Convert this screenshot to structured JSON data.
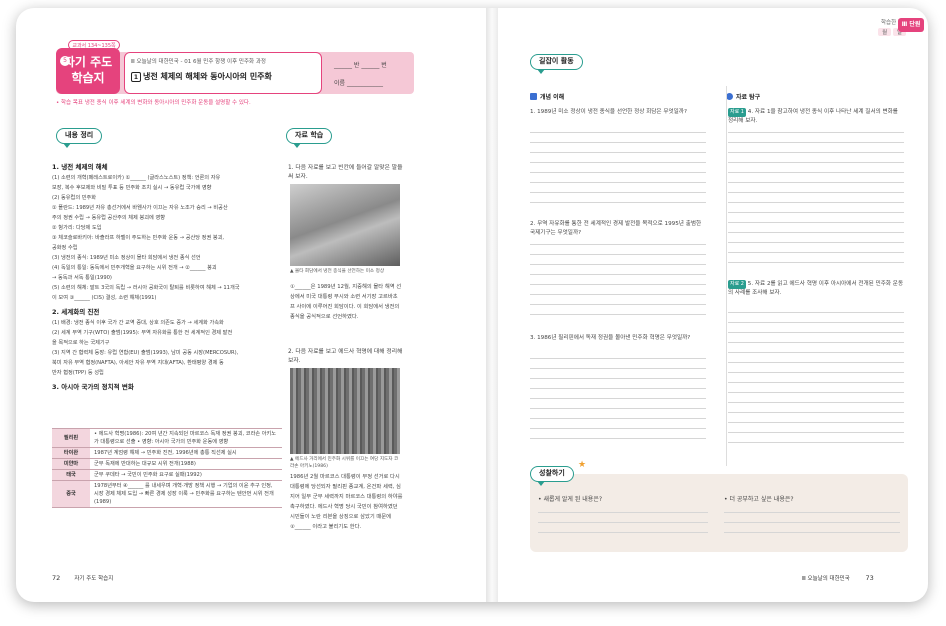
{
  "left_page": {
    "textbook_ref": "교과서 134~135쪽",
    "logo_line1": "자기 주도",
    "logo_line2": "학습지",
    "logo_badge": "5",
    "chapter_path": "Ⅲ 오늘날의 대한민국 - 01 6월 민주 항쟁 이후 민주화 과정",
    "lesson_title": "냉전 체제의 해체와 동아시아의 민주화",
    "lesson_number": "1",
    "class_field": "______ 반 ______ 번",
    "name_field": "이름 ____________",
    "goal": "• 학습 목표  냉전 종식 이후 세계의 변화와 동아시아의 민주화 운동을 설명할 수 있다.",
    "section_summary": "내용 정리",
    "section_material": "자료 학습",
    "summary": {
      "h1": "1. 냉전 체제의 해체",
      "s1": [
        "(1) 소련의 개혁(페레스트로이카) ①______ (글라스노스트) 정책: 언론의 자유",
        "보장, 복수 후보제와 비밀 투표 등 민주화 조치 실시 → 동유럽 국가에 영향",
        "(2) 동유럽의 민주화",
        "① 폴란드: 1989년 자유 총선거에서 바웬사가 이끄는 자유 노조가 승리 → 비공산",
        "주의 정권 수립 → 동유럽 공산주의 체제 붕괴에 영향",
        "② 헝가리: 다당제 도입",
        "③ 체코슬로바키아: 바츨라프 하벨이 주도하는 민주화 운동 → 공산당 정권 붕괴,",
        "공화정 수립",
        "(3) 냉전의 종식: 1989년 미소 정상이 몰타 회담에서 냉전 종식 선언",
        "(4) 독일의 통일: 동독에서 민주개혁을 요구하는 시위 전개 → ②______ 붕괴",
        "→ 동독과 서독 통일(1990)",
        "(5) 소련의 해체: 발트 3국의 독립 → 러시아 공화국이 탈퇴를 비롯하여 해체 → 11개국",
        "이 모여 ③______ (CIS) 결성, 소련 해체(1991)"
      ],
      "h2": "2. 세계화의 진전",
      "s2": [
        "(1) 배경: 냉전 종식 이후 국가 간 교역 증대, 상호 의존도 증가 → 세계화 가속화",
        "(2) 세계 무역 기구(WTO) 출범(1995): 무역 자유화를 통한 전 세계적인 경제 발전",
        "을 목적으로 하는 국제기구",
        "(3) 지역 간 협력체 등장: 유럽 연합(EU) 출범(1993), 남미 공동 시장(MERCOSUR),",
        "북미 자유 무역 협정(NAFTA), 아세안 자유 무역 지대(AFTA), 환태평양 경제 동",
        "반자 협정(TPP) 등 성립"
      ],
      "h3": "3. 아시아 국가의 정치적 변화",
      "table": [
        {
          "k": "필리핀",
          "v": "• 에드사 혁명(1986): 20여 년간 지속되던 마르코스 독재 정권 붕괴, 코라손 아키노가 대통령으로 선출 • 영향: 아시아 국가의 민주화 운동에 영향"
        },
        {
          "k": "타이완",
          "v": "1987년 계엄령 해제 → 민주화 진전, 1996년에 총통 직선제 실시"
        },
        {
          "k": "미얀마",
          "v": "군부 독재에 반대하는 대규모 시위 전개(1988)"
        },
        {
          "k": "태국",
          "v": "군부 쿠데타 → 국민이 민주화 요구로 실패(1992)"
        },
        {
          "k": "중국",
          "v": "1978년부터 ④______ 를 내세우며 개혁·개방 정책 시행 → 기업의 이윤 추구 인정, 시장 경제 체제 도입 → 빠른 경제 성장 이룩 → 민주화를 요구하는 텐안먼 시위 전개(1989)"
        }
      ]
    },
    "material": {
      "q1": "1. 다음 자료를 보고 빈칸에 들어갈 알맞은 말을 써 보자.",
      "cap1": "▲ 몰타 회담에서 냉전 종식을 선언하는 미소 정상",
      "p1": [
        "①______은 1989년 12월, 지중해의 몰타 해역 선상에서 미국 대통령 부시와 소련 서기장 고르바초프 사이에 이루어진 회담이다. 이 회담에서 냉전의 종식을 공식적으로 선언하였다."
      ],
      "q2": "2. 다음 자료를 보고 에드사 혁명에 대해 정리해 보자.",
      "cap2": "▲ 에드사 거리에서 민주화 시위를 이끄는 여당 지도자 코라손 아키노(1986)",
      "p2": "1986년 2월 마르코스 대통령이 부정 선거로 다시 대통령에 당선되자 필리핀 종교계, 온건파 세력, 심지어 일부 군부 세력까지 마르코스 대통령의 하야를 촉구하였다. 에드사 혁명 당시 국민이 참여하였던 시민들이 노란 리본을 상징으로 삼았기 때문에 ②______ 이라고 불리기도 한다."
    },
    "footer_page": "72",
    "footer_title": "자기 주도 학습지"
  },
  "right_page": {
    "header_top": "학습한 날",
    "header_month": "월",
    "header_day": "일",
    "unit_label": "Ⅲ 단원",
    "section_activity": "길잡이 활동",
    "col1_title": "개념 이해",
    "col2_title": "자료 탐구",
    "q1": "1. 1989년 미소 정상이 냉전 종식을 선언한 정상 회담은 무엇일까?",
    "q2": "2. 무역 자유화를 통한 전 세계적인 경제 발전을 목적으로 1995년 출범한 국제기구는 무엇일까?",
    "q3": "3. 1986년 필리핀에서 독재 정권을 몰아낸 민주화 혁명은 무엇일까?",
    "q4_tag": "자료 1",
    "q4": "4. 자료 1을 참고하여 냉전 종식 이후 나타난 세계 질서의 변화를 정리해 보자.",
    "q5_tag": "자료 2",
    "q5": "5. 자료 2를 읽고 에드사 혁명 이후 아시아에서 전개된 민주화 운동의 사례를 조사해 보자.",
    "review_title": "성찰하기",
    "review_q1": "• 새롭게 알게 된 내용은?",
    "review_q2": "• 더 공부하고 싶은 내용은?",
    "footer_title": "Ⅲ 오늘날의 대한민국",
    "footer_page": "73"
  },
  "colors": {
    "accent_pink": "#e5437d",
    "accent_teal": "#2a9d8f",
    "check_blue": "#3b6fd1"
  }
}
